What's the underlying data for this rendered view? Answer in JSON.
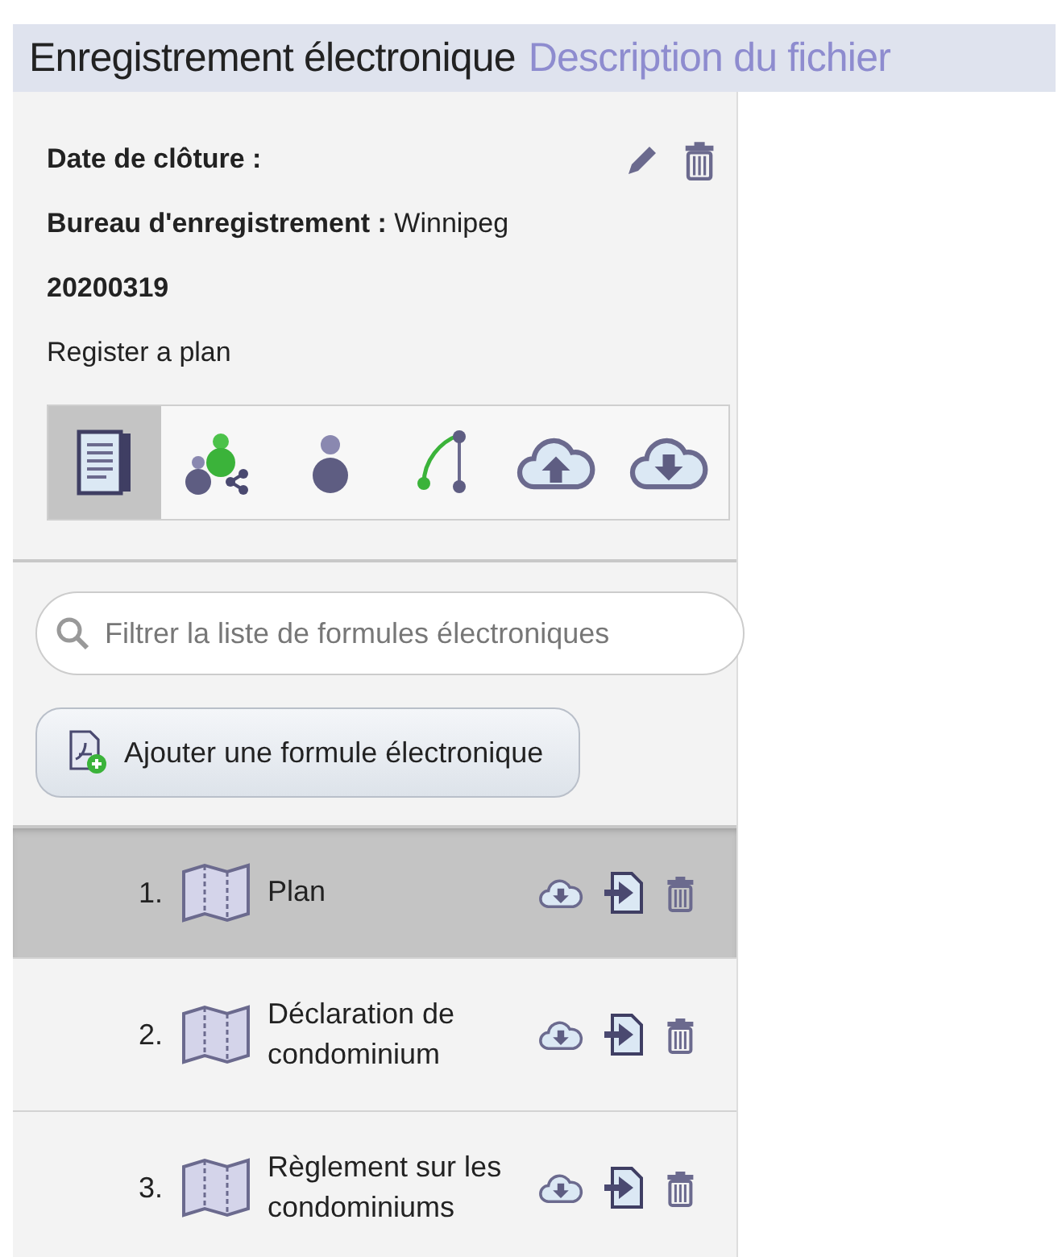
{
  "header": {
    "title": "Enregistrement électronique",
    "subtitle": "Description du fichier"
  },
  "details": {
    "closing_date_label": "Date de clôture :",
    "office_label": "Bureau d'enregistrement :",
    "office_value": "Winnipeg",
    "number": "20200319",
    "description": "Register a plan"
  },
  "toolbar": [
    {
      "kind": "document",
      "selected": true
    },
    {
      "kind": "share",
      "selected": false
    },
    {
      "kind": "person",
      "selected": false
    },
    {
      "kind": "path",
      "selected": false
    },
    {
      "kind": "upload",
      "selected": false
    },
    {
      "kind": "download",
      "selected": false
    }
  ],
  "search": {
    "placeholder": "Filtrer la liste de formules électroniques"
  },
  "add_button": "Ajouter une formule électronique",
  "forms": [
    {
      "number": "1.",
      "name": "Plan",
      "selected": true
    },
    {
      "number": "2.",
      "name": "Déclaration de condominium",
      "selected": false
    },
    {
      "number": "3.",
      "name": "Règlement sur les condominiums",
      "selected": false
    }
  ]
}
